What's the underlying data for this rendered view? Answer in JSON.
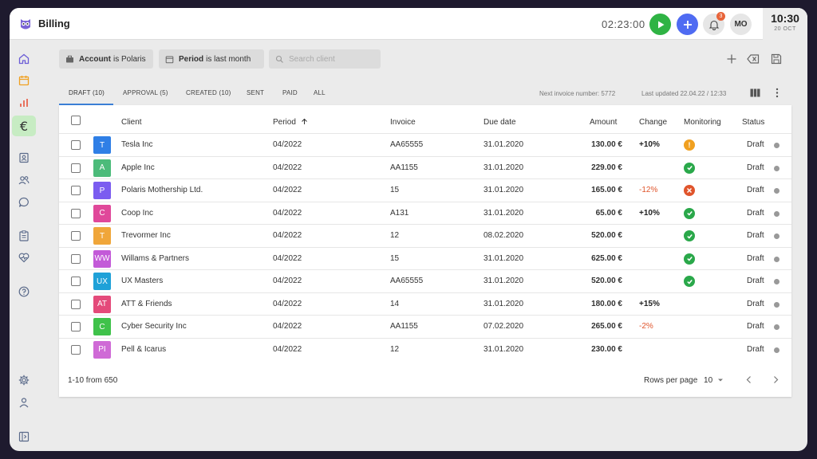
{
  "app": {
    "title": "Billing"
  },
  "header": {
    "timer": "02:23:00",
    "notifications_count": "3",
    "user_initials": "MO",
    "clock_time": "10:30",
    "clock_date": "20 OCT"
  },
  "filters": {
    "account_label": "Account",
    "account_value": "is Polaris",
    "period_label": "Period",
    "period_value": "is last month",
    "search_placeholder": "Search client"
  },
  "tabs": [
    "DRAFT (10)",
    "APPROVAL (5)",
    "CREATED (10)",
    "SENT",
    "PAID",
    "ALL"
  ],
  "meta": {
    "next_invoice": "Next invoice number: 5772",
    "last_updated": "Last updated 22.04.22 / 12:33"
  },
  "columns": {
    "client": "Client",
    "period": "Period",
    "invoice": "Invoice",
    "due_date": "Due date",
    "amount": "Amount",
    "change": "Change",
    "monitoring": "Monitoring",
    "status": "Status"
  },
  "rows": [
    {
      "initials": "T",
      "color": "#2f7fe6",
      "client": "Tesla Inc",
      "period": "04/2022",
      "invoice": "AA65555",
      "due": "31.01.2020",
      "amount": "130.00 €",
      "change": "+10%",
      "change_type": "pos",
      "monitoring": "warning",
      "status": "Draft"
    },
    {
      "initials": "A",
      "color": "#4cbb7a",
      "client": "Apple Inc",
      "period": "04/2022",
      "invoice": "AA1155",
      "due": "31.01.2020",
      "amount": "229.00 €",
      "change": "",
      "change_type": "",
      "monitoring": "ok",
      "status": "Draft"
    },
    {
      "initials": "P",
      "color": "#7b5cf0",
      "client": "Polaris Mothership Ltd.",
      "period": "04/2022",
      "invoice": "15",
      "due": "31.01.2020",
      "amount": "165.00 €",
      "change": "-12%",
      "change_type": "neg",
      "monitoring": "error",
      "status": "Draft"
    },
    {
      "initials": "C",
      "color": "#e0489a",
      "client": "Coop Inc",
      "period": "04/2022",
      "invoice": "A131",
      "due": "31.01.2020",
      "amount": "65.00 €",
      "change": "+10%",
      "change_type": "pos",
      "monitoring": "ok",
      "status": "Draft"
    },
    {
      "initials": "T",
      "color": "#f0a63a",
      "client": "Trevormer Inc",
      "period": "04/2022",
      "invoice": "12",
      "due": "08.02.2020",
      "amount": "520.00 €",
      "change": "",
      "change_type": "",
      "monitoring": "ok",
      "status": "Draft"
    },
    {
      "initials": "WW",
      "color": "#c35ad8",
      "client": "Willams & Partners",
      "period": "04/2022",
      "invoice": "15",
      "due": "31.01.2020",
      "amount": "625.00 €",
      "change": "",
      "change_type": "",
      "monitoring": "ok",
      "status": "Draft"
    },
    {
      "initials": "UX",
      "color": "#1fa1d8",
      "client": "UX Masters",
      "period": "04/2022",
      "invoice": "AA65555",
      "due": "31.01.2020",
      "amount": "520.00 €",
      "change": "",
      "change_type": "",
      "monitoring": "ok",
      "status": "Draft"
    },
    {
      "initials": "AT",
      "color": "#e44a7a",
      "client": "ATT & Friends",
      "period": "04/2022",
      "invoice": "14",
      "due": "31.01.2020",
      "amount": "180.00 €",
      "change": "+15%",
      "change_type": "pos",
      "monitoring": "",
      "status": "Draft"
    },
    {
      "initials": "C",
      "color": "#3fc24a",
      "client": "Cyber Security Inc",
      "period": "04/2022",
      "invoice": "AA1155",
      "due": "07.02.2020",
      "amount": "265.00 €",
      "change": "-2%",
      "change_type": "neg",
      "monitoring": "",
      "status": "Draft"
    },
    {
      "initials": "PI",
      "color": "#cf6ad6",
      "client": "Pell & Icarus",
      "period": "04/2022",
      "invoice": "12",
      "due": "31.01.2020",
      "amount": "230.00 €",
      "change": "",
      "change_type": "",
      "monitoring": "",
      "status": "Draft"
    }
  ],
  "footer": {
    "range": "1-10 from 650",
    "rows_per_page_label": "Rows per page",
    "rows_per_page_value": "10"
  },
  "colors": {
    "accent_blue": "#3b7fd6",
    "play_green": "#2fb344",
    "add_blue": "#4f6bf2",
    "ok_green": "#2aa84a",
    "warning_orange": "#f0a020",
    "error_red": "#e0552c",
    "active_nav_bg": "#c7ecc3"
  },
  "monitoring_icons": {
    "ok": "check-circle-icon",
    "warning": "exclamation-circle-icon",
    "error": "x-circle-icon"
  }
}
